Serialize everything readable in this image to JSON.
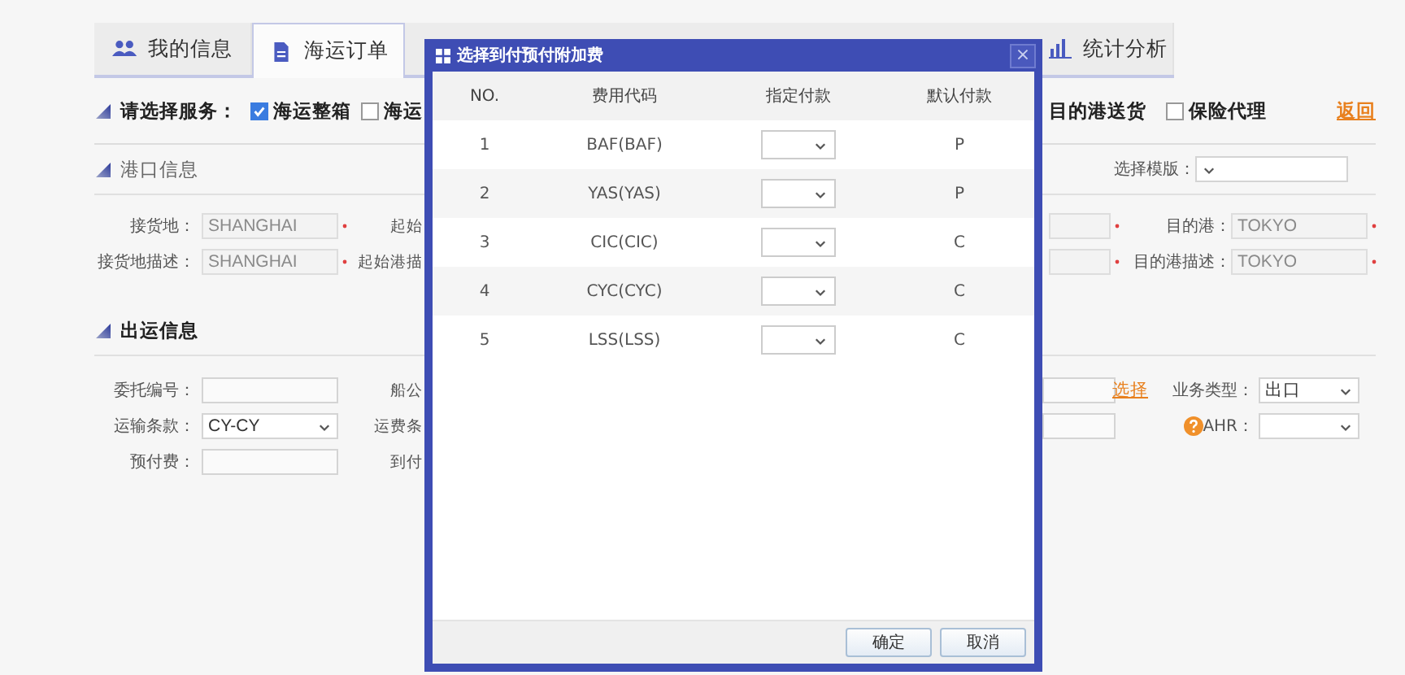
{
  "tabs": [
    {
      "label": "我的信息",
      "selected": false
    },
    {
      "label": "海运订单",
      "selected": true
    },
    {
      "label": "统计分析",
      "selected": false
    }
  ],
  "services": {
    "label": "请选择服务：",
    "left_options": [
      {
        "label": "海运整箱",
        "checked": true
      },
      {
        "label": "海运",
        "checked": false
      }
    ],
    "right_options": [
      {
        "label": "目的港送货"
      },
      {
        "label": "保险代理",
        "checked": false
      }
    ],
    "back_link": "返回"
  },
  "port_info": {
    "title": "港口信息",
    "template": {
      "label": "选择模版："
    },
    "rows": [
      {
        "left": [
          {
            "kind": "field",
            "label": "接货地：",
            "value": "SHANGHAI",
            "required": true,
            "disabled": true
          },
          {
            "kind": "label",
            "text": "起始"
          }
        ],
        "right": [
          {
            "kind": "field",
            "required": true,
            "disabled": true
          },
          {
            "kind": "field",
            "label": "目的港：",
            "value": "TOKYO",
            "required": true,
            "disabled": true
          }
        ]
      },
      {
        "left": [
          {
            "kind": "field",
            "label": "接货地描述：",
            "value": "SHANGHAI",
            "required": true,
            "disabled": true
          },
          {
            "kind": "label",
            "text": "起始港描"
          }
        ],
        "right": [
          {
            "kind": "field",
            "required": true,
            "disabled": true
          },
          {
            "kind": "field",
            "label": "目的港描述：",
            "value": "TOKYO",
            "required": true,
            "disabled": true
          }
        ]
      }
    ]
  },
  "shipping_info": {
    "title": "出运信息",
    "rows": [
      {
        "left": [
          {
            "kind": "field",
            "label": "委托编号："
          },
          {
            "kind": "label",
            "text": "船公"
          }
        ],
        "right": [
          {
            "kind": "field"
          },
          {
            "kind": "link",
            "text": "选择"
          },
          {
            "kind": "select",
            "label": "业务类型：",
            "value": "出口"
          }
        ]
      },
      {
        "left": [
          {
            "kind": "select",
            "label": "运输条款：",
            "value": "CY-CY"
          },
          {
            "kind": "label",
            "text": "运费条"
          }
        ],
        "right": [
          {
            "kind": "field"
          },
          {
            "kind": "select",
            "label": "AHR：",
            "help": true
          }
        ]
      },
      {
        "left": [
          {
            "kind": "field",
            "label": "预付费："
          },
          {
            "kind": "label",
            "text": "到付"
          }
        ],
        "right": []
      }
    ]
  },
  "dialog": {
    "title": "选择到付预付附加费",
    "close": "×",
    "columns": [
      "NO.",
      "费用代码",
      "指定付款",
      "默认付款"
    ],
    "rows": [
      {
        "no": "1",
        "code": "BAF(BAF)",
        "default": "P"
      },
      {
        "no": "2",
        "code": "YAS(YAS)",
        "default": "P"
      },
      {
        "no": "3",
        "code": "CIC(CIC)",
        "default": "C"
      },
      {
        "no": "4",
        "code": "CYC(CYC)",
        "default": "C"
      },
      {
        "no": "5",
        "code": "LSS(LSS)",
        "default": "C"
      }
    ],
    "buttons": [
      "确定",
      "取消"
    ]
  }
}
